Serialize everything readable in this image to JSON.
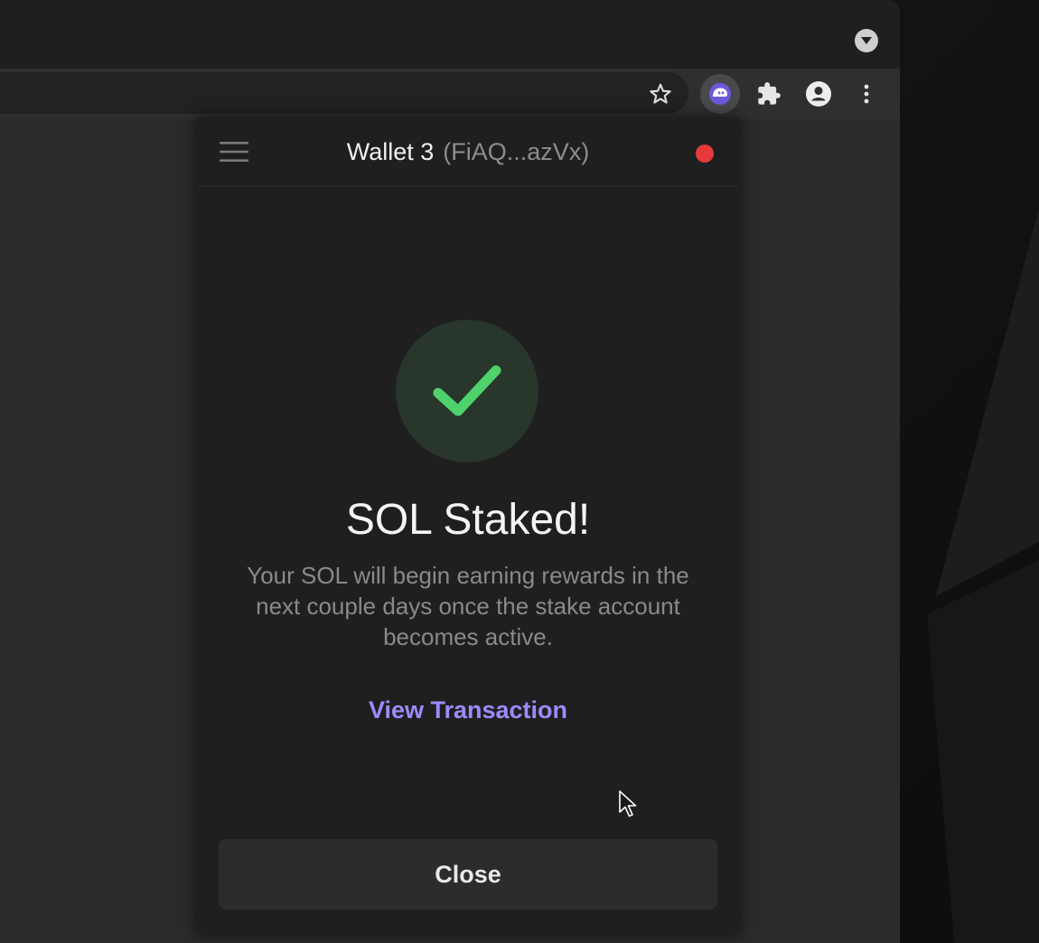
{
  "toolbar": {
    "icons": [
      "bookmark-star-icon",
      "phantom-extension-icon",
      "extensions-puzzle-icon",
      "profile-icon",
      "more-menu-icon"
    ]
  },
  "popup": {
    "wallet_name": "Wallet 3",
    "wallet_address": "(FiAQ...azVx)",
    "status_color": "#e5393b",
    "headline": "SOL Staked!",
    "description": "Your SOL will begin earning rewards in the next couple days once the stake account becomes active.",
    "view_transaction_label": "View Transaction",
    "close_label": "Close"
  },
  "colors": {
    "success_green": "#4fd26b",
    "accent_purple": "#9b8cff"
  }
}
